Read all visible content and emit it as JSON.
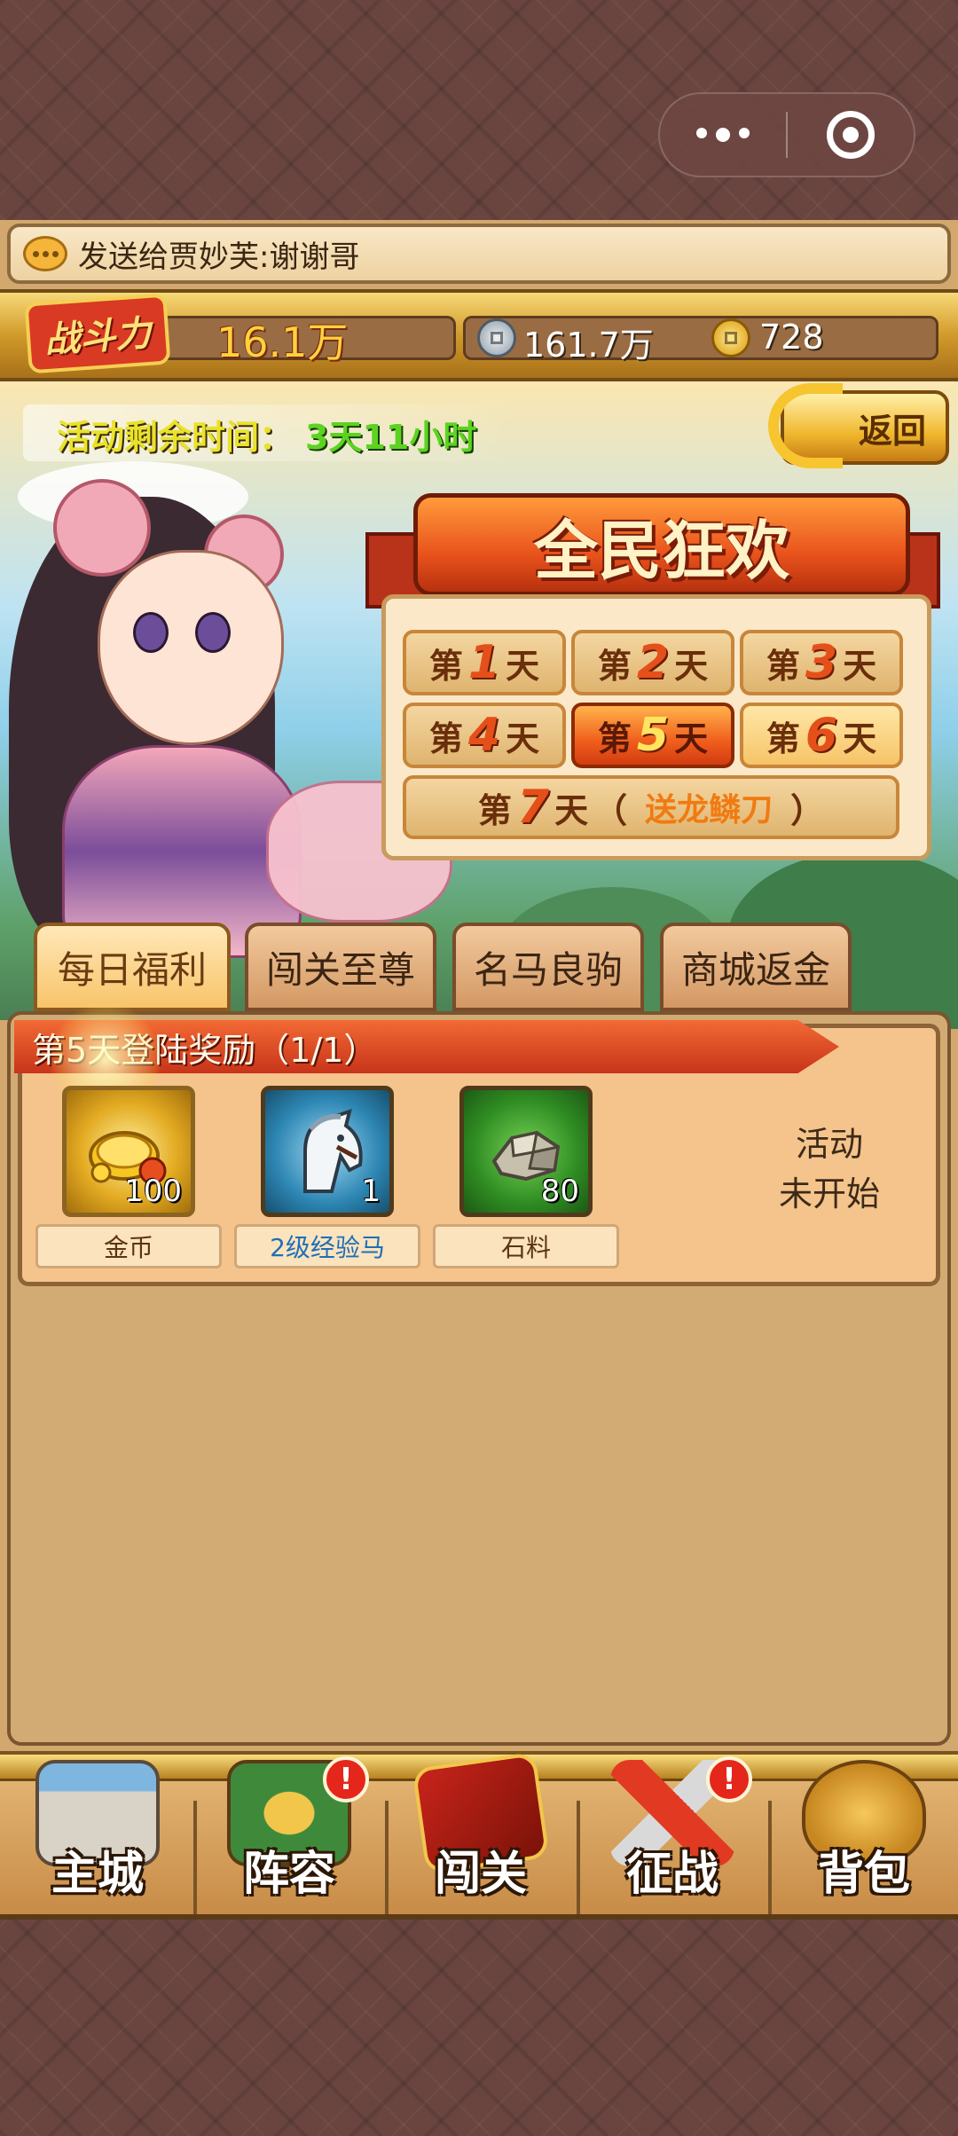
{
  "capsule": {
    "more_icon": "more-dots-icon",
    "close_icon": "close-target-icon"
  },
  "chat": {
    "message": "发送给贾妙芙:谢谢哥"
  },
  "resources": {
    "power_label": "战斗力",
    "power_value": "16.1万",
    "silver_value": "161.7万",
    "gold_value": "728"
  },
  "event": {
    "remaining_label": "活动剩余时间：",
    "remaining_value": "3天11小时",
    "back_label": "返回",
    "title": "全民狂欢",
    "day_prefix": "第",
    "day_suffix": "天",
    "days": [
      {
        "num": "1",
        "state": "done"
      },
      {
        "num": "2",
        "state": "done"
      },
      {
        "num": "3",
        "state": "done"
      },
      {
        "num": "4",
        "state": "done"
      },
      {
        "num": "5",
        "state": "active"
      },
      {
        "num": "6",
        "state": "upcoming"
      }
    ],
    "day7": {
      "num": "7",
      "open": "（",
      "reward": "送龙鳞刀",
      "close": "）"
    }
  },
  "tabs": [
    {
      "label": "每日福利",
      "active": true
    },
    {
      "label": "闯关至尊",
      "active": false
    },
    {
      "label": "名马良驹",
      "active": false
    },
    {
      "label": "商城返金",
      "active": false
    }
  ],
  "reward": {
    "title": "第5天登陆奖励（1/1）",
    "items": [
      {
        "name": "金币",
        "count": "100",
        "icon": "gold-coins-icon",
        "name_color": "#5a3512"
      },
      {
        "name": "2级经验马",
        "count": "1",
        "icon": "white-horse-icon",
        "name_color": "#1e6fb8"
      },
      {
        "name": "石料",
        "count": "80",
        "icon": "stone-icon",
        "name_color": "#5a3512"
      }
    ],
    "status_line1": "活动",
    "status_line2": "未开始"
  },
  "nav": [
    {
      "label": "主城",
      "icon": "castle-icon",
      "badge": ""
    },
    {
      "label": "阵容",
      "icon": "formation-icon",
      "badge": "!"
    },
    {
      "label": "闯关",
      "icon": "scroll-flag-icon",
      "badge": ""
    },
    {
      "label": "征战",
      "icon": "crossed-swords-icon",
      "badge": "!"
    },
    {
      "label": "背包",
      "icon": "bag-icon",
      "badge": ""
    }
  ],
  "colors": {
    "accent_orange": "#e9531c",
    "gold": "#f0b72d",
    "badge_red": "#e4271a"
  }
}
